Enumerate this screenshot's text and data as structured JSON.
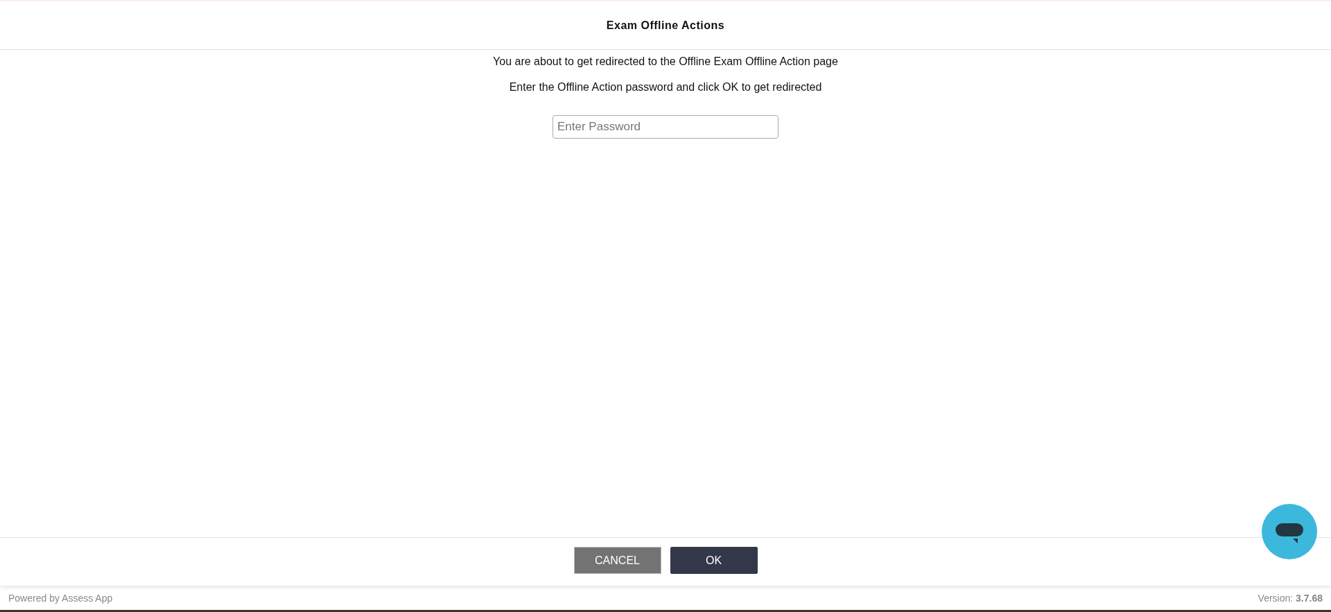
{
  "dialog": {
    "title": "Exam Offline Actions",
    "messages": [
      "You are about to get redirected to the Offline Exam Offline Action page",
      "Enter the Offline Action password and click OK to get redirected"
    ],
    "password_field": {
      "placeholder": "Enter Password"
    },
    "buttons": [
      {
        "label": "CANCEL",
        "kind": "secondary"
      },
      {
        "label": "OK",
        "kind": "primary"
      }
    ]
  },
  "footer": {
    "left": "Powered by Assess App",
    "right": "Version: **3.7.68**"
  }
}
